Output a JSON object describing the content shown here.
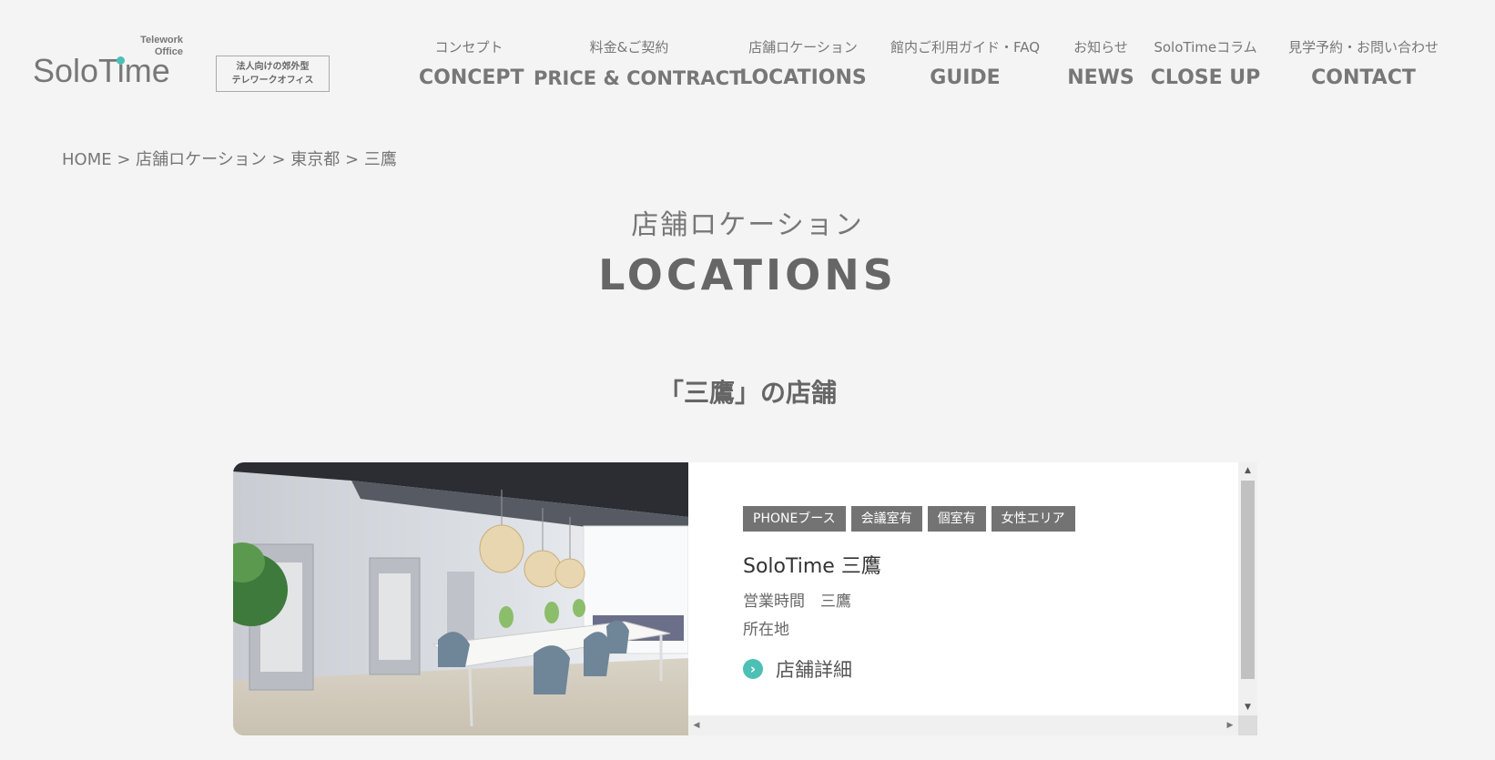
{
  "logo": {
    "tagline": "Telework\nOffice",
    "name": "SoloTime",
    "badge_line1": "法人向けの郊外型",
    "badge_line2": "テレワークオフィス"
  },
  "nav": [
    {
      "jp": "コンセプト",
      "en": "CONCEPT"
    },
    {
      "jp": "料金&ご契約",
      "en": "PRICE & CONTRACT"
    },
    {
      "jp": "店舗ロケーション",
      "en": "LOCATIONS"
    },
    {
      "jp": "館内ご利用ガイド・FAQ",
      "en": "GUIDE"
    },
    {
      "jp": "お知らせ",
      "en": "NEWS"
    },
    {
      "jp": "SoloTimeコラム",
      "en": "CLOSE UP"
    },
    {
      "jp": "見学予約・お問い合わせ",
      "en": "CONTACT"
    }
  ],
  "breadcrumb": "HOME > 店舗ロケーション > 東京都 > 三鷹",
  "section": {
    "jp": "店舗ロケーション",
    "en": "LOCATIONS",
    "area_title": "「三鷹」の店舗"
  },
  "store": {
    "tags": [
      "PHONEブース",
      "会議室有",
      "個室有",
      "女性エリア"
    ],
    "name": "SoloTime 三鷹",
    "hours": "営業時間　三鷹",
    "address": "所在地",
    "detail_link": "店舗詳細"
  },
  "colors": {
    "accent": "#4cc0b4",
    "tag_bg": "#737373",
    "bg": "#f4f4f4"
  }
}
